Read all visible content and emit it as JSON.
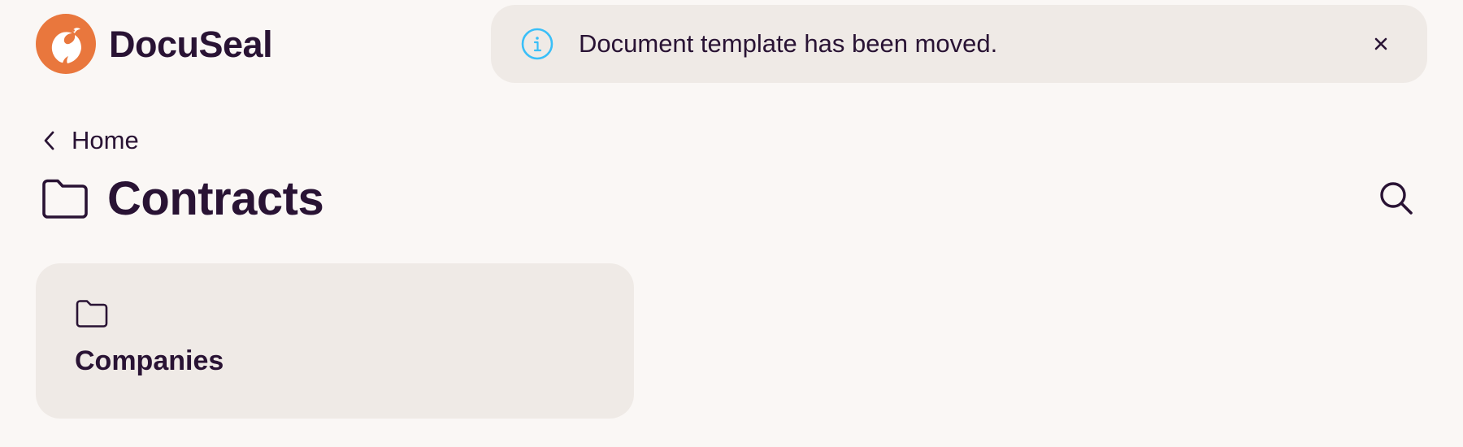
{
  "app": {
    "name": "DocuSeal"
  },
  "toast": {
    "message": "Document template has been moved.",
    "icon": "info-icon",
    "close_icon": "close-icon",
    "accent_color": "#3abff8"
  },
  "breadcrumb": {
    "label": "Home",
    "icon": "chevron-left-icon"
  },
  "page": {
    "title": "Contracts",
    "icon": "folder-icon",
    "search_icon": "search-icon"
  },
  "folders": [
    {
      "name": "Companies",
      "icon": "folder-icon"
    }
  ],
  "theme": {
    "background": "#faf7f5",
    "card_background": "#efeae6",
    "text": "#291334",
    "brand_orange": "#e9773d"
  }
}
